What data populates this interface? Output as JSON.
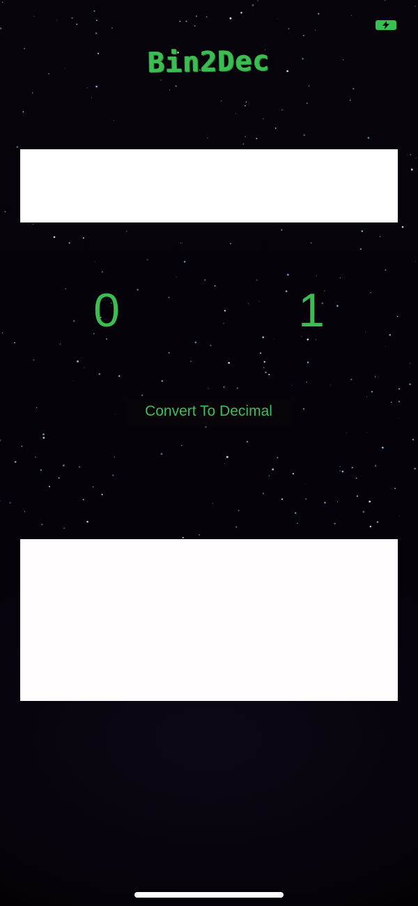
{
  "app": {
    "title": "Bin2Dec"
  },
  "input": {
    "value": "",
    "placeholder": ""
  },
  "keypad": {
    "zero_label": "0",
    "one_label": "1"
  },
  "convert_button": {
    "label": "Convert To Decimal"
  },
  "result": {
    "value": ""
  },
  "colors": {
    "accent": "#3bbd51",
    "background": "#050206",
    "field": "#ffffff"
  },
  "icons": {
    "status": "battery-charging-icon"
  }
}
